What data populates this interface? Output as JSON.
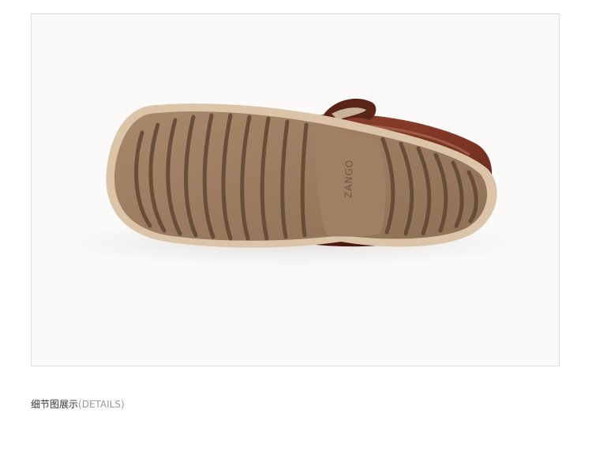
{
  "product_image": {
    "subject": "shoe-sole-bottom-view",
    "sole_imprint": "ZANGO",
    "colors": {
      "background": "#fbfaf9",
      "outsole": "#9c7c5f",
      "midsole": "#dcc4a8",
      "upper_leather": "#6a2a1c",
      "tread_groove": "#5e4632"
    }
  },
  "caption": {
    "title": "细节图展示",
    "subtitle": "(DETAILS)"
  }
}
